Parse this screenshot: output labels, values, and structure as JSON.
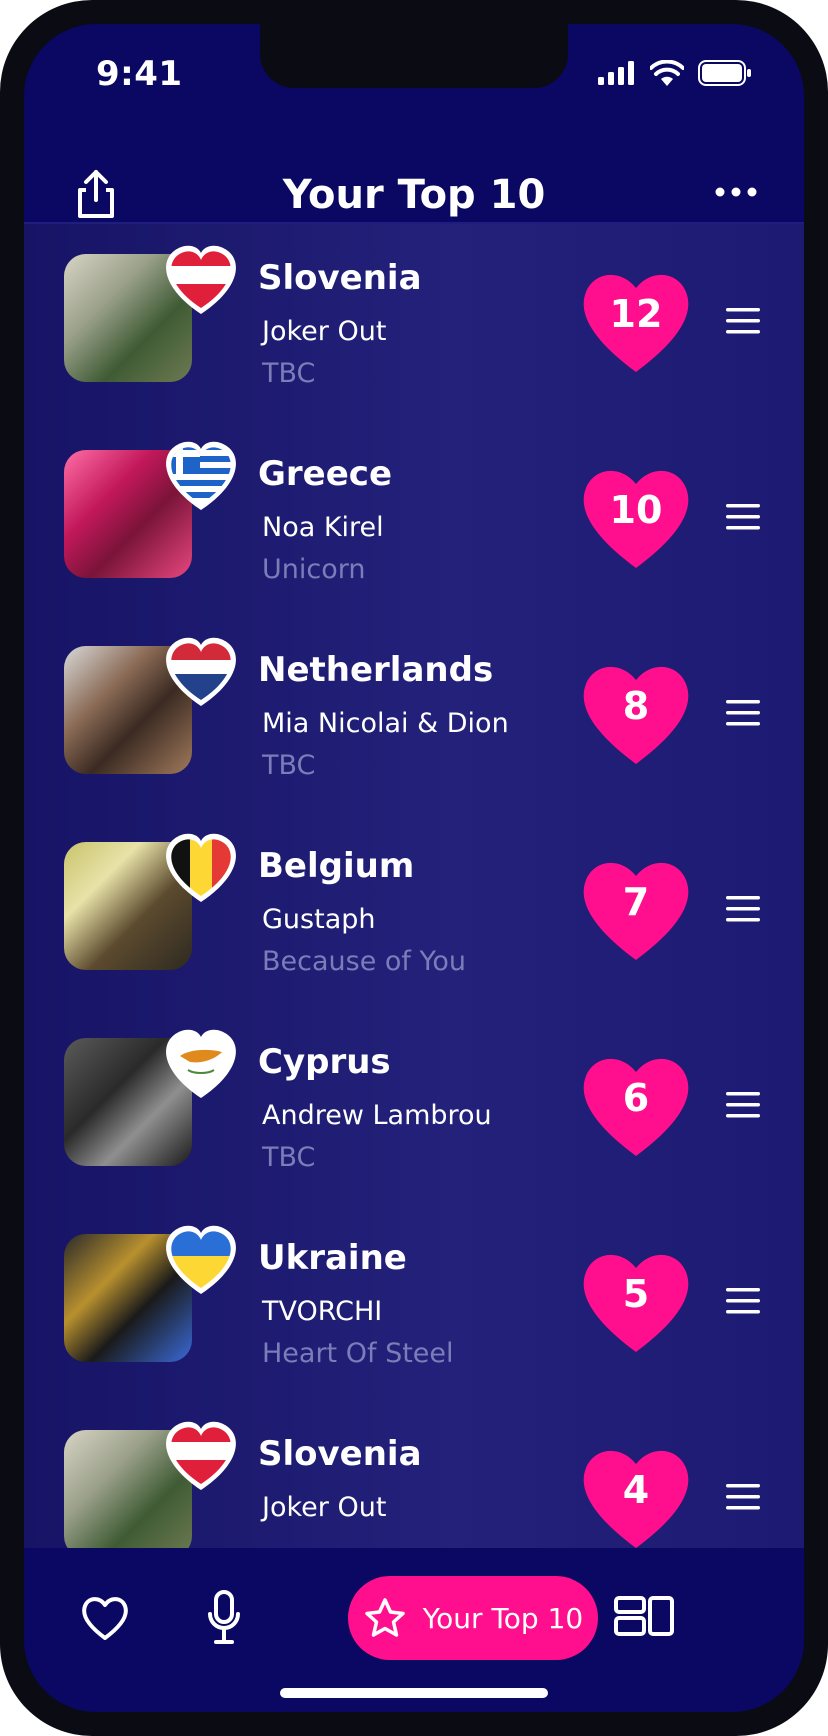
{
  "status_bar": {
    "time": "9:41"
  },
  "header": {
    "title": "Your Top 10"
  },
  "rows": [
    {
      "country": "Slovenia",
      "artist": "Joker Out",
      "song": "TBC",
      "points": "12",
      "flag": "austria-style-red-white-red"
    },
    {
      "country": "Greece",
      "artist": "Noa Kirel",
      "song": "Unicorn",
      "points": "10",
      "flag": "greece"
    },
    {
      "country": "Netherlands",
      "artist": "Mia Nicolai & Dion",
      "song": "TBC",
      "points": "8",
      "flag": "netherlands"
    },
    {
      "country": "Belgium",
      "artist": "Gustaph",
      "song": "Because of You",
      "points": "7",
      "flag": "belgium"
    },
    {
      "country": "Cyprus",
      "artist": "Andrew Lambrou",
      "song": "TBC",
      "points": "6",
      "flag": "cyprus"
    },
    {
      "country": "Ukraine",
      "artist": "TVORCHI",
      "song": "Heart Of Steel",
      "points": "5",
      "flag": "ukraine"
    },
    {
      "country": "Slovenia",
      "artist": "Joker Out",
      "song": "",
      "points": "4",
      "flag": "austria-style-red-white-red"
    }
  ],
  "tab_bar": {
    "active_label": "Your Top 10",
    "icons": [
      "heart-icon",
      "microphone-icon",
      "star-icon",
      "grid-icon"
    ]
  },
  "colors": {
    "background": "#0a0862",
    "accent_pink": "#ff0f8e",
    "secondary_text": "#7b7cb8"
  }
}
